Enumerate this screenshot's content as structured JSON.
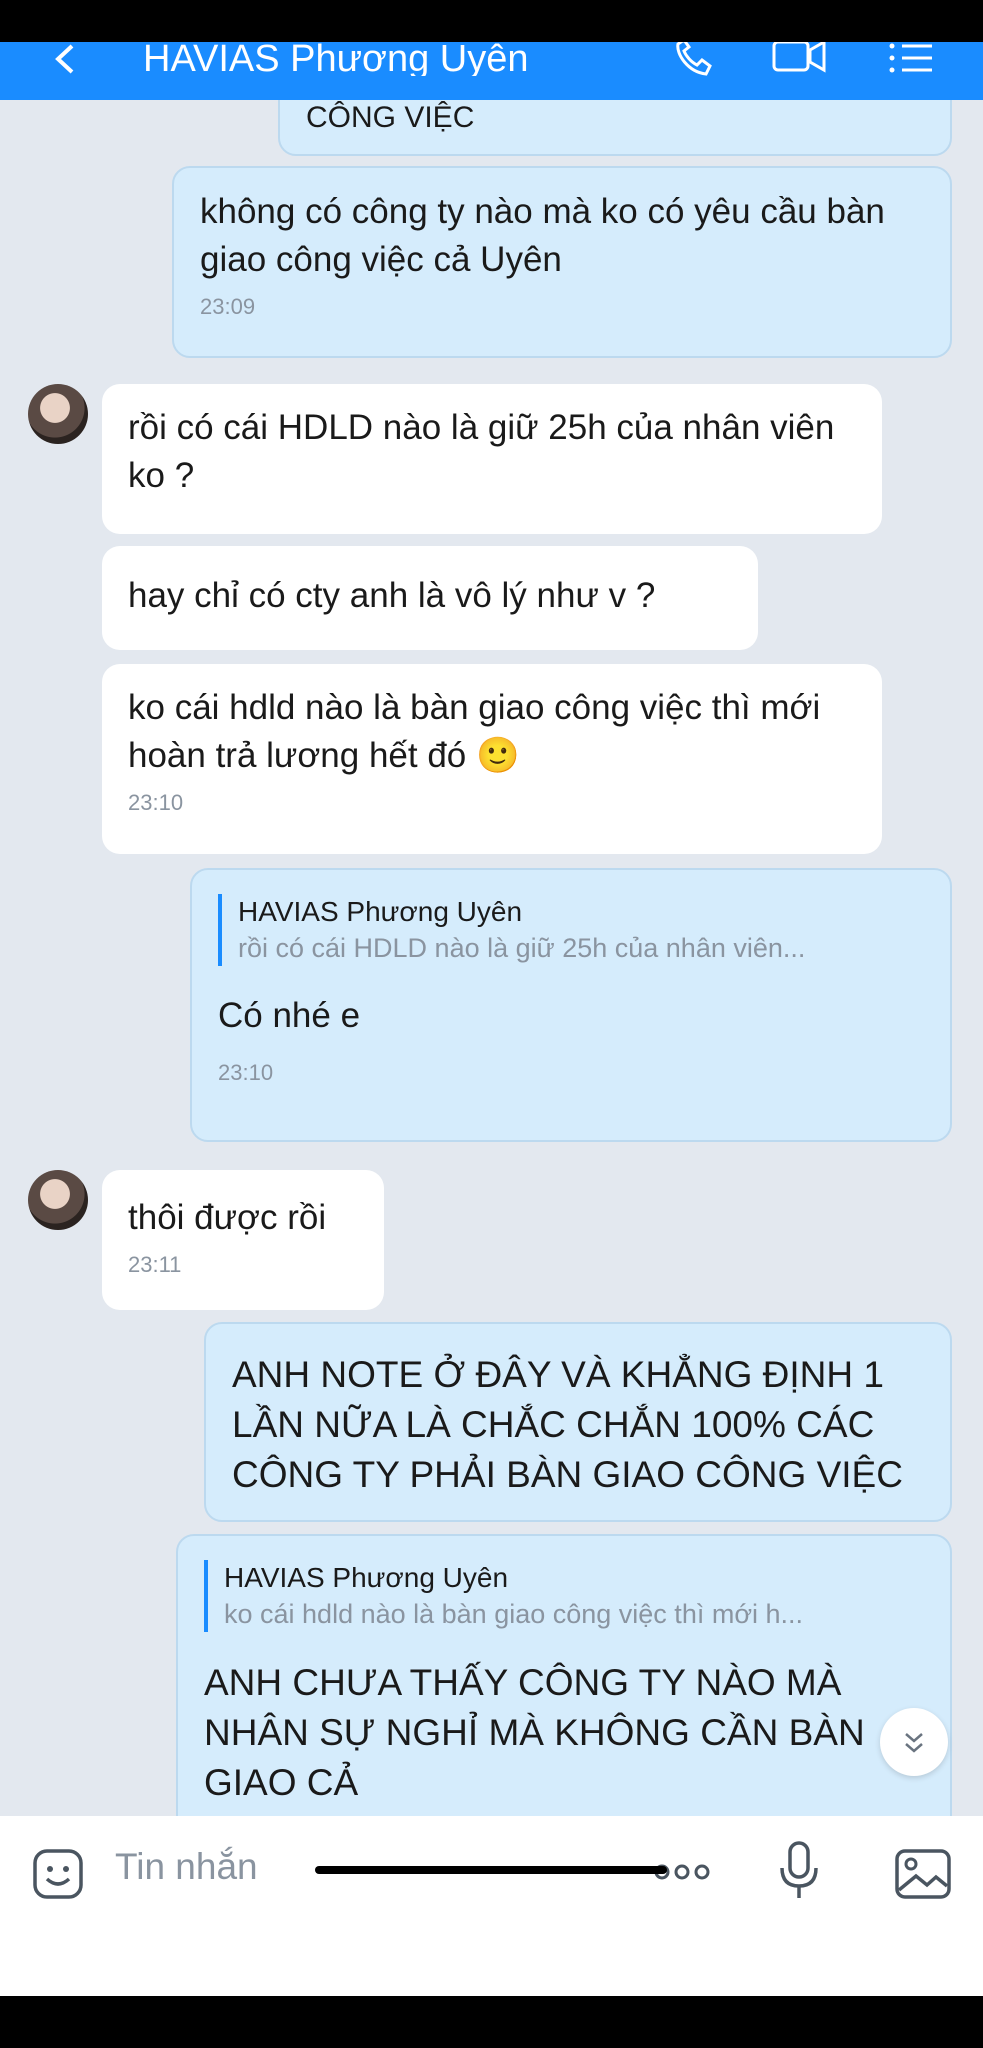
{
  "header": {
    "back_icon": "chevron-left-icon",
    "title": "HAVIAS Phương Uyên",
    "icons": [
      "phone-icon",
      "video-call-icon",
      "menu-icon"
    ],
    "color": "#1a8cff"
  },
  "messages": {
    "m0": {
      "text": "CÔNG VIỆC"
    },
    "m1": {
      "text": "không có công ty nào mà ko có yêu cầu bàn giao công việc cả Uyên",
      "time": "23:09"
    },
    "m2": {
      "text": "rồi có cái HDLD nào là giữ 25h của nhân viên ko ?"
    },
    "m3": {
      "text": "hay chỉ có cty anh là vô lý như v ?"
    },
    "m4": {
      "text": "ko cái hdld nào là bàn giao công việc thì mới hoàn trả lương hết đó",
      "emoji": "🙂",
      "time": "23:10"
    },
    "m5": {
      "quote_name": "HAVIAS Phương Uyên",
      "quote_text": "rồi có cái HDLD nào là giữ 25h của nhân viên...",
      "text": "Có nhé e",
      "time": "23:10"
    },
    "m6": {
      "text": "thôi được rồi",
      "time": "23:11"
    },
    "m7": {
      "text": "ANH NOTE Ở ĐÂY VÀ KHẲNG ĐỊNH 1 LẦN NỮA LÀ CHẮC CHẮN 100% CÁC CÔNG TY PHẢI BÀN GIAO CÔNG VIỆC"
    },
    "m8": {
      "quote_name": "HAVIAS Phương Uyên",
      "quote_text": "ko cái hdld nào là bàn giao công việc thì mới h...",
      "text": "ANH CHƯA THẤY CÔNG TY NÀO MÀ NHÂN SỰ NGHỈ MÀ KHÔNG CẦN BÀN GIAO CẢ"
    }
  },
  "scroll_down_icon": "double-chevron-down-icon",
  "input": {
    "placeholder": "Tin nhắn",
    "icons": [
      "sticker-icon",
      "more-icon",
      "microphone-icon",
      "image-icon"
    ]
  }
}
